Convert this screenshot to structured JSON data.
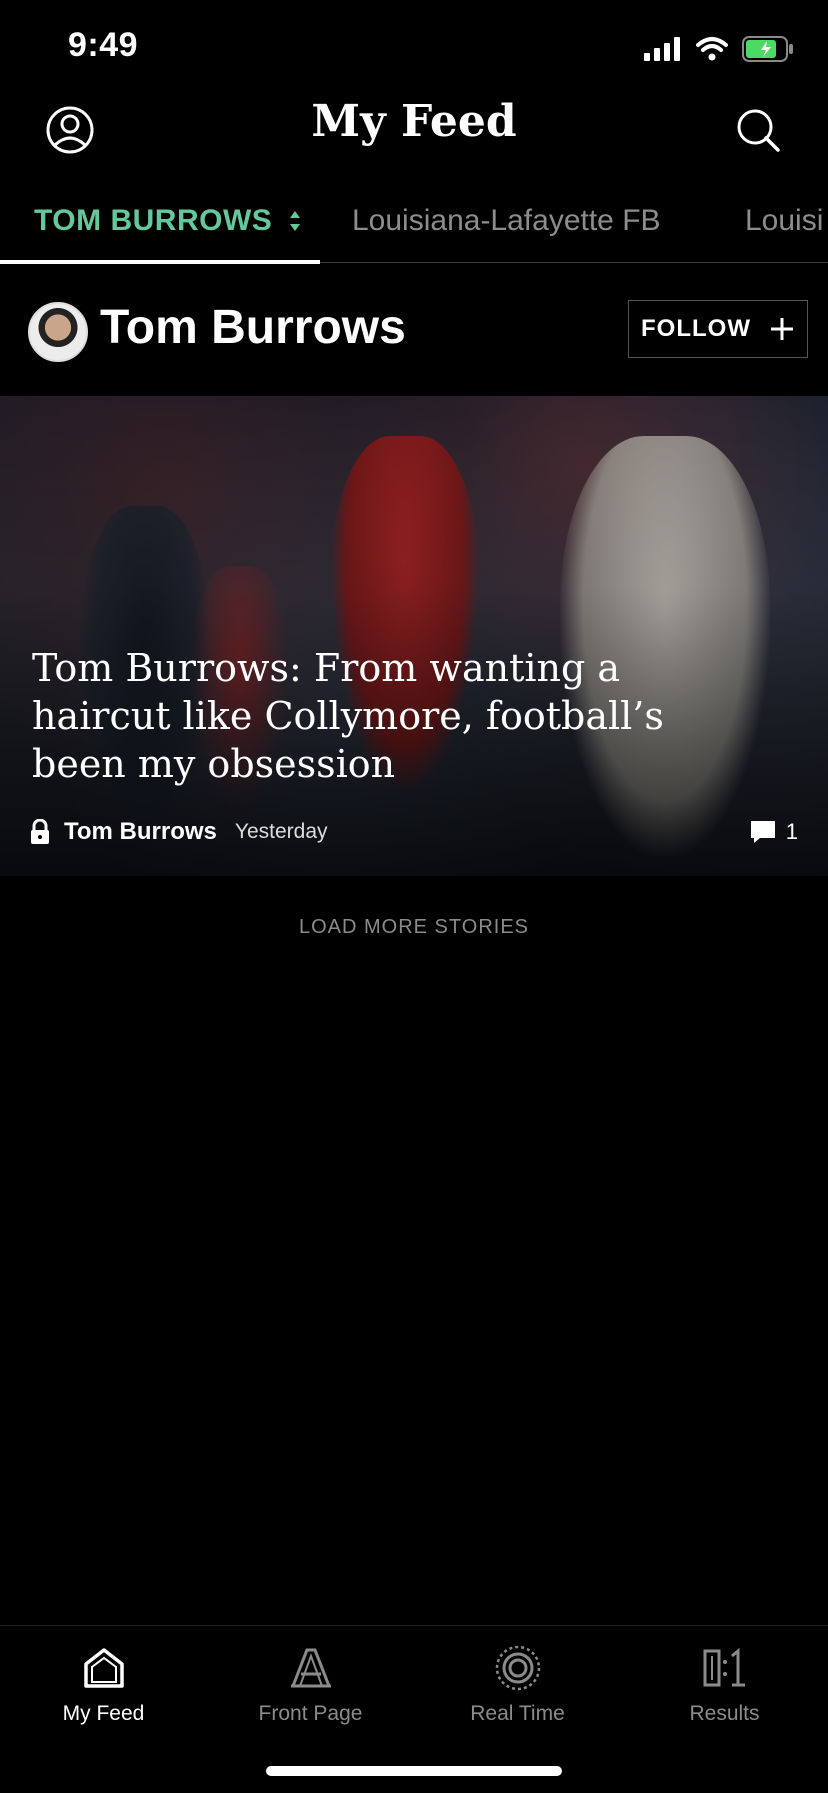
{
  "status_bar": {
    "time": "9:49"
  },
  "header": {
    "title": "My Feed"
  },
  "tabs": [
    {
      "label": "TOM BURROWS",
      "active": true
    },
    {
      "label": "Louisiana-Lafayette FB",
      "active": false
    },
    {
      "label": "Louisi",
      "active": false
    }
  ],
  "author": {
    "name": "Tom Burrows",
    "follow_label": "FOLLOW"
  },
  "story": {
    "title": "Tom Burrows: From wanting a haircut like Collymore, football’s been my obsession",
    "author": "Tom Burrows",
    "time": "Yesterday",
    "comments": "1"
  },
  "load_more": "LOAD MORE STORIES",
  "bottom_nav": [
    {
      "label": "My Feed",
      "icon": "home-icon",
      "active": true
    },
    {
      "label": "Front Page",
      "icon": "front-page-icon",
      "active": false
    },
    {
      "label": "Real Time",
      "icon": "real-time-icon",
      "active": false
    },
    {
      "label": "Results",
      "icon": "results-icon",
      "active": false
    }
  ],
  "colors": {
    "accent": "#63c99d",
    "background": "#000000",
    "muted": "#8b8b8b"
  }
}
